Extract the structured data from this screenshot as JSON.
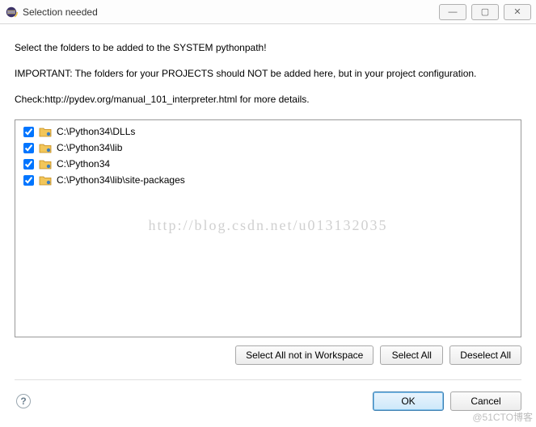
{
  "title": "Selection needed",
  "messages": {
    "line1": "Select the folders to be added to the SYSTEM pythonpath!",
    "line2": "IMPORTANT: The folders for your PROJECTS should NOT be added here, but in your project configuration.",
    "line3": "Check:http://pydev.org/manual_101_interpreter.html for more details."
  },
  "items": [
    {
      "checked": true,
      "path": "C:\\Python34\\DLLs"
    },
    {
      "checked": true,
      "path": "C:\\Python34\\lib"
    },
    {
      "checked": true,
      "path": "C:\\Python34"
    },
    {
      "checked": true,
      "path": "C:\\Python34\\lib\\site-packages"
    }
  ],
  "watermark": "http://blog.csdn.net/u013132035",
  "buttons": {
    "select_not_ws": "Select All not in Workspace",
    "select_all": "Select All",
    "deselect_all": "Deselect All",
    "ok": "OK",
    "cancel": "Cancel"
  },
  "corner_watermark": "@51CTO博客"
}
